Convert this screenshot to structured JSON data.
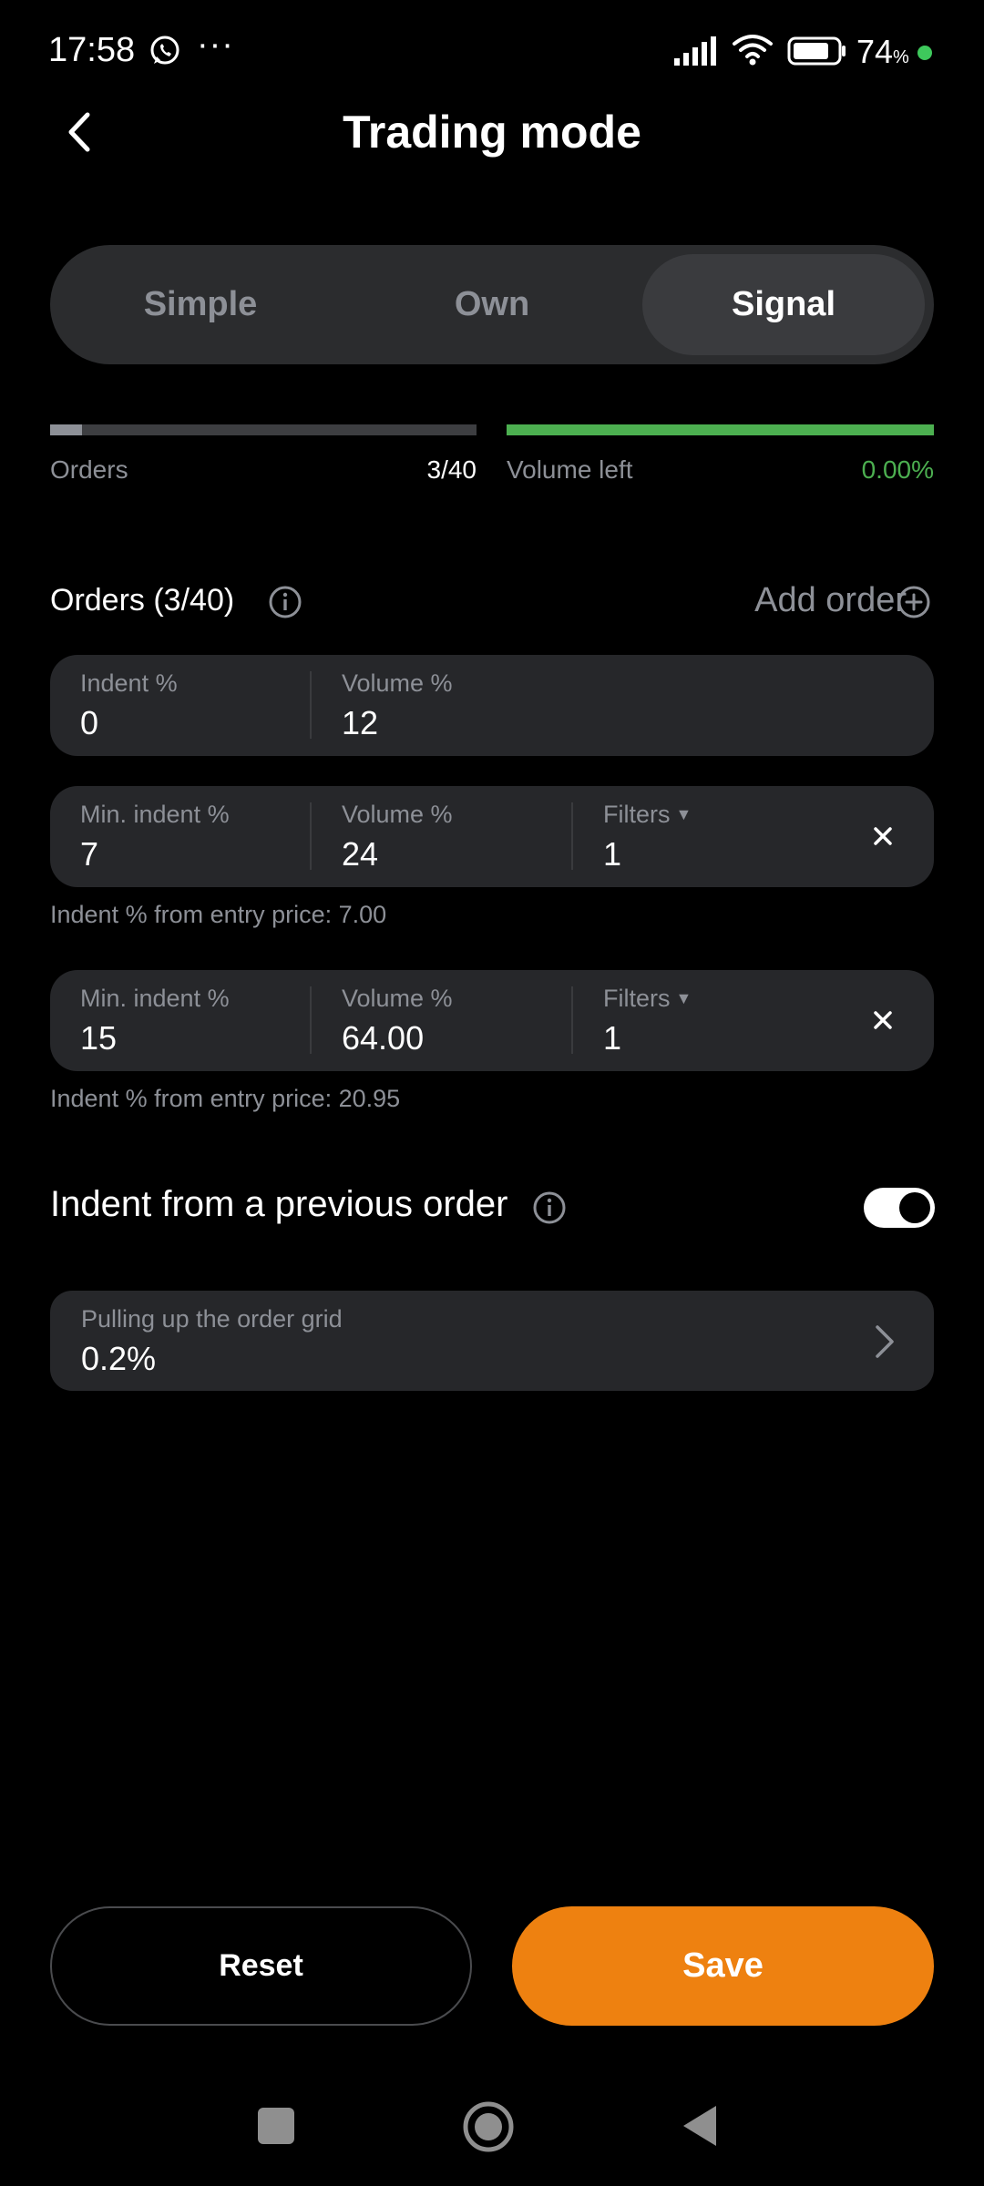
{
  "status_bar": {
    "time": "17:58",
    "more": "···",
    "battery": "74",
    "battery_unit": "%",
    "icons": [
      "whatsapp-icon",
      "signal-icon",
      "wifi-icon",
      "battery-icon"
    ]
  },
  "header": {
    "title": "Trading mode",
    "back_icon": "chevron-left-icon"
  },
  "mode_tabs": [
    {
      "label": "Simple",
      "active": false
    },
    {
      "label": "Own",
      "active": false
    },
    {
      "label": "Signal",
      "active": true
    }
  ],
  "progress": {
    "orders_label": "Orders",
    "orders_value": "3/40",
    "orders_fraction": 0.075,
    "volume_label": "Volume left",
    "volume_value": "0.00%",
    "volume_fraction": 1.0
  },
  "orders_section": {
    "title": "Orders (3/40)",
    "add_label": "Add order"
  },
  "orders": [
    {
      "indent_label": "Indent %",
      "indent_value": "0",
      "volume_label": "Volume %",
      "volume_value": "12"
    },
    {
      "indent_label": "Min. indent %",
      "indent_value": "7",
      "volume_label": "Volume %",
      "volume_value": "24",
      "filters_label": "Filters",
      "filters_value": "1",
      "hint": "Indent % from entry price: 7.00"
    },
    {
      "indent_label": "Min. indent %",
      "indent_value": "15",
      "volume_label": "Volume %",
      "volume_value": "64.00",
      "filters_label": "Filters",
      "filters_value": "1",
      "hint": "Indent % from entry price: 20.95"
    }
  ],
  "indent_toggle": {
    "label": "Indent from a previous order",
    "enabled": true
  },
  "pull_grid": {
    "label": "Pulling up the order grid",
    "value": "0.2%"
  },
  "buttons": {
    "reset": "Reset",
    "save": "Save"
  },
  "colors": {
    "accent": "#ee8110",
    "success": "#4caf50",
    "muted": "#8d9097"
  }
}
